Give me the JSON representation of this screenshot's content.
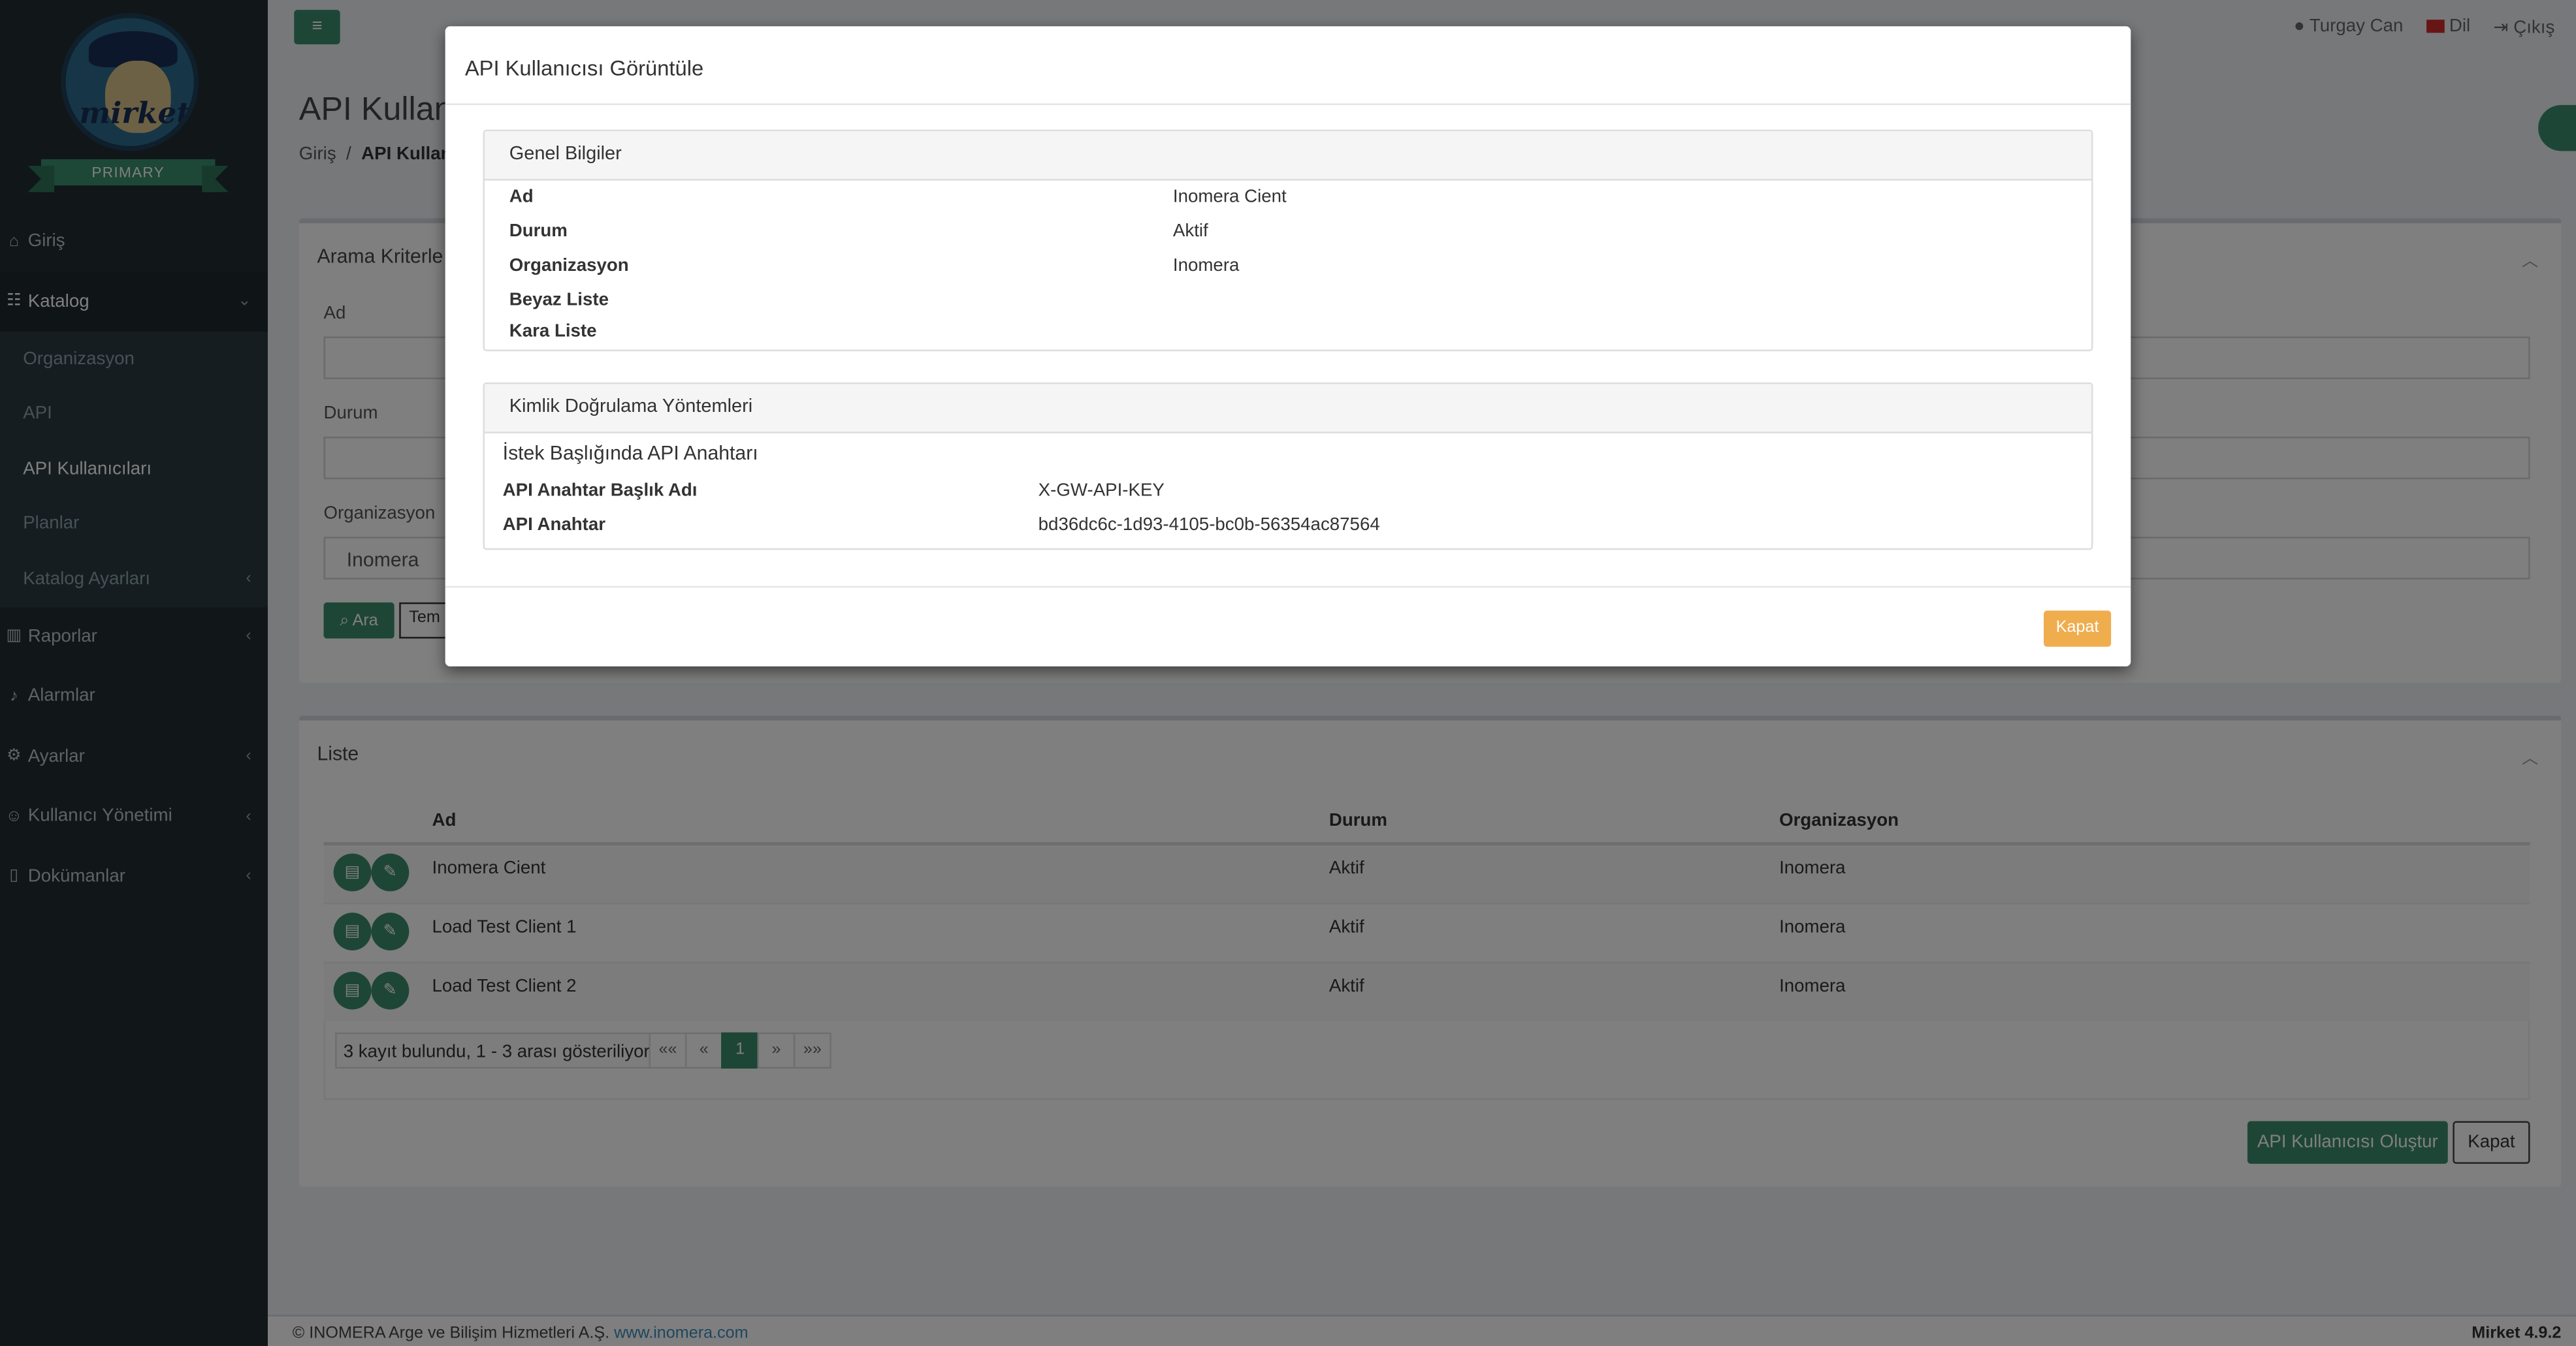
{
  "header": {
    "user_name": "Turgay Can",
    "language": "Dil",
    "logout": "Çıkış"
  },
  "logo": {
    "text": "mirket",
    "ribbon": "PRIMARY"
  },
  "sidebar": {
    "home": "Giriş",
    "catalog": "Katalog",
    "catalog_items": [
      "Organizasyon",
      "API",
      "API Kullanıcıları",
      "Planlar",
      "Katalog Ayarları"
    ],
    "reports": "Raporlar",
    "alarms": "Alarmlar",
    "settings": "Ayarlar",
    "user_management": "Kullanıcı Yönetimi",
    "documents": "Dokümanlar"
  },
  "page": {
    "title": "API Kullanıc",
    "breadcrumb_home": "Giriş",
    "breadcrumb_sep": "/",
    "breadcrumb_current": "API Kullan"
  },
  "search": {
    "title": "Arama Kriterle",
    "label_name": "Ad",
    "label_status": "Durum",
    "label_org": "Organizasyon",
    "org_value": "Inomera",
    "search_button": "Ara",
    "clear_button": "Tem"
  },
  "list": {
    "title": "Liste",
    "columns": [
      "Ad",
      "Durum",
      "Organizasyon"
    ],
    "rows": [
      {
        "name": "Inomera Cient",
        "status": "Aktif",
        "org": "Inomera"
      },
      {
        "name": "Load Test Client 1",
        "status": "Aktif",
        "org": "Inomera"
      },
      {
        "name": "Load Test Client 2",
        "status": "Aktif",
        "org": "Inomera"
      }
    ],
    "record_info": "3 kayıt bulundu, 1 - 3 arası gösteriliyor.",
    "pager": [
      "««",
      "«",
      "1",
      "»",
      "»»"
    ],
    "create_button": "API Kullanıcısı Oluştur",
    "close_button": "Kapat"
  },
  "footer": {
    "copyright": "© INOMERA Arge ve Bilişim Hizmetleri A.Ş.",
    "link": "www.inomera.com",
    "version": "Mirket 4.9.2"
  },
  "modal": {
    "title": "API Kullanıcısı Görüntüle",
    "general": {
      "title": "Genel Bilgiler",
      "fields": [
        {
          "key": "Ad",
          "value": "Inomera Cient"
        },
        {
          "key": "Durum",
          "value": "Aktif"
        },
        {
          "key": "Organizasyon",
          "value": "Inomera"
        },
        {
          "key": "Beyaz Liste",
          "value": ""
        },
        {
          "key": "Kara Liste",
          "value": ""
        }
      ]
    },
    "auth": {
      "title": "Kimlik Doğrulama Yöntemleri",
      "subtitle": "İstek Başlığında API Anahtarı",
      "fields": [
        {
          "key": "API Anahtar Başlık Adı",
          "value": "X-GW-API-KEY"
        },
        {
          "key": "API Anahtar",
          "value": "bd36dc6c-1d93-4105-bc0b-56354ac87564"
        }
      ]
    },
    "close_button": "Kapat"
  }
}
